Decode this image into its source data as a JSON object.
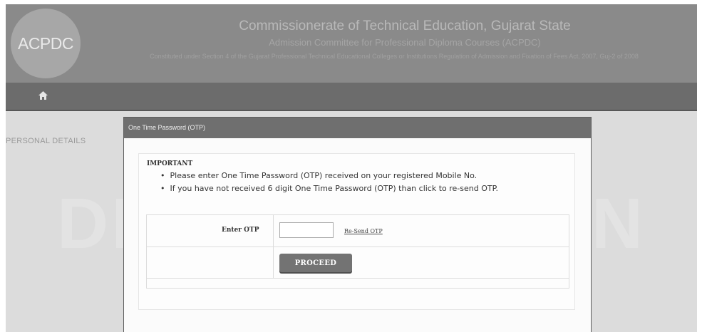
{
  "header": {
    "logo_text": "ACPDC",
    "title": "Commissionerate of Technical Education, Gujarat State",
    "subtitle": "Admission Committee for Professional Diploma Courses (ACPDC)",
    "constitution": "Constituted under Section 4 of the Gujarat Professional Technical Educational Colleges or Institutions Regulation of Admission and Fixation of Fees Act, 2007, Guj-2 of 2008"
  },
  "nav": {
    "home_icon": "home-icon"
  },
  "sidebar": {
    "label": "PERSONAL DETAILS"
  },
  "watermark": "DEMO VERSION",
  "modal": {
    "title": "One Time Password (OTP)",
    "important_label": "IMPORTANT",
    "instructions": [
      "Please enter One Time Password (OTP) received on your registered Mobile No.",
      "If you have not received 6 digit One Time Password (OTP) than click to re-send OTP."
    ],
    "otp_label": "Enter OTP",
    "otp_value": "",
    "resend_label": "Re-Send OTP",
    "proceed_label": "PROCEED"
  }
}
